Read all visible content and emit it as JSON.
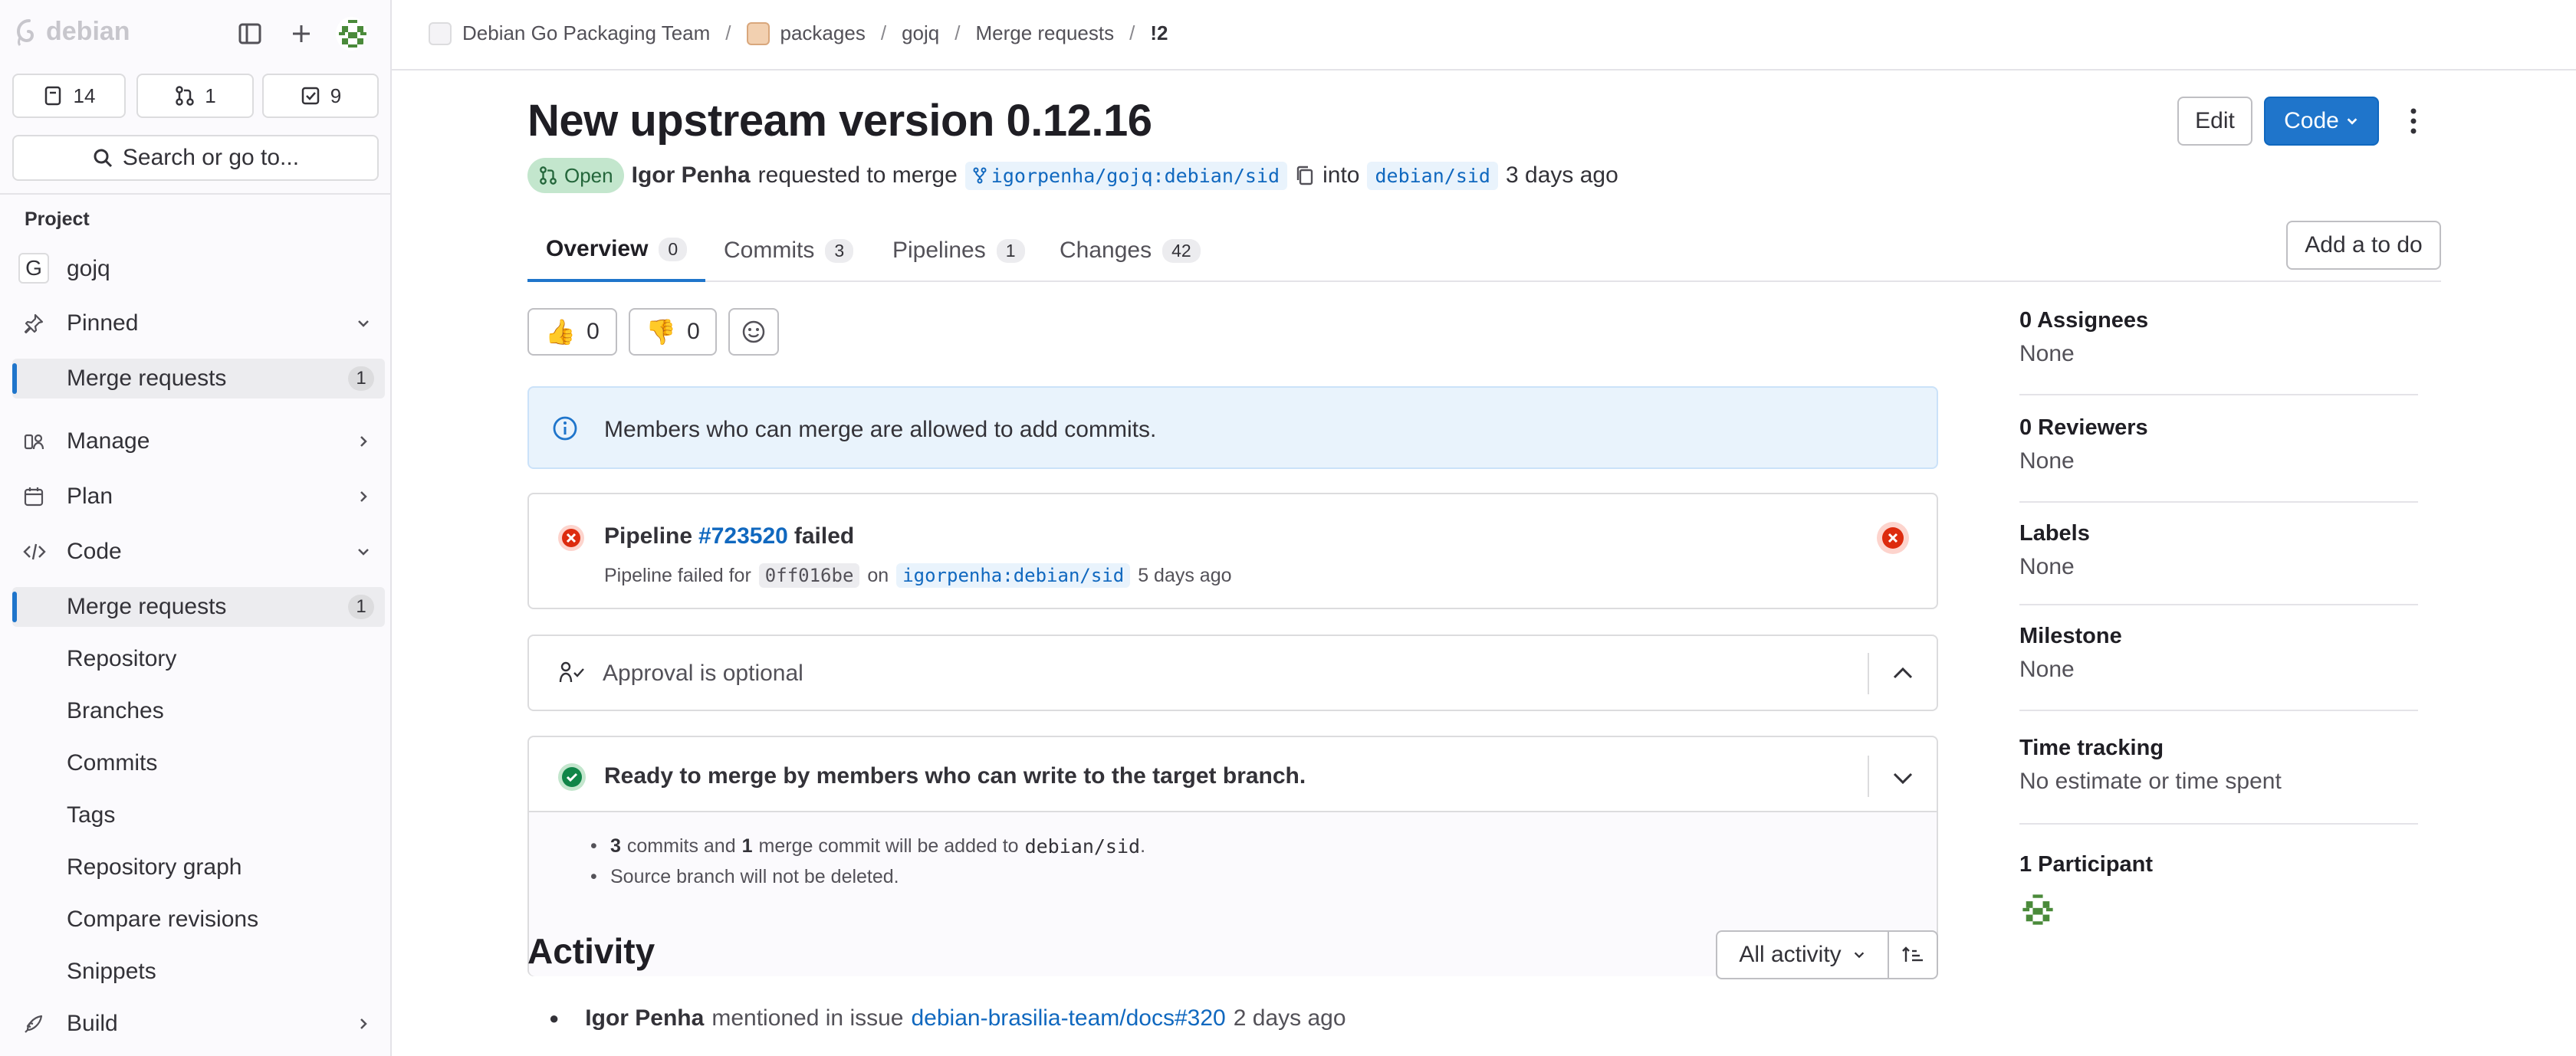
{
  "sidebar": {
    "logo_text": "debian",
    "counters": [
      {
        "icon": "issues-icon",
        "count": "14"
      },
      {
        "icon": "merge-request-icon",
        "count": "1"
      },
      {
        "icon": "todo-icon",
        "count": "9"
      }
    ],
    "search_label": "Search or go to...",
    "section_label": "Project",
    "project_initial": "G",
    "project_name": "gojq",
    "pinned_label": "Pinned",
    "pinned_items": [
      {
        "label": "Merge requests",
        "count": "1"
      }
    ],
    "manage_label": "Manage",
    "plan_label": "Plan",
    "code_label": "Code",
    "code_items": [
      {
        "label": "Merge requests",
        "count": "1"
      },
      {
        "label": "Repository"
      },
      {
        "label": "Branches"
      },
      {
        "label": "Commits"
      },
      {
        "label": "Tags"
      },
      {
        "label": "Repository graph"
      },
      {
        "label": "Compare revisions"
      },
      {
        "label": "Snippets"
      }
    ],
    "build_label": "Build"
  },
  "breadcrumb": [
    "Debian Go Packaging Team",
    "packages",
    "gojq",
    "Merge requests",
    "!2"
  ],
  "mr": {
    "title": "New upstream version 0.12.16",
    "edit_label": "Edit",
    "code_label": "Code",
    "status": "Open",
    "author": "Igor Penha",
    "requested_text": "requested to merge",
    "source_branch": "igorpenha/gojq:debian/sid",
    "into_text": "into",
    "target_branch": "debian/sid",
    "age": "3 days ago",
    "todo_label": "Add a to do"
  },
  "tabs": [
    {
      "label": "Overview",
      "count": "0"
    },
    {
      "label": "Commits",
      "count": "3"
    },
    {
      "label": "Pipelines",
      "count": "1"
    },
    {
      "label": "Changes",
      "count": "42"
    }
  ],
  "reactions": {
    "thumbs_up": "0",
    "thumbs_down": "0",
    "thumbs_up_glyph": "👍",
    "thumbs_down_glyph": "👎"
  },
  "info_banner": "Members who can merge are allowed to add commits.",
  "pipeline": {
    "label": "Pipeline",
    "id": "#723520",
    "status": "failed",
    "detail_prefix": "Pipeline failed for",
    "commit": "0ff016be",
    "on_text": "on",
    "branch": "igorpenha:debian/sid",
    "age": "5 days ago"
  },
  "approval": {
    "text": "Approval is optional"
  },
  "merge": {
    "title": "Ready to merge by members who can write to the target branch.",
    "line1_a": "3",
    "line1_b": "commits and",
    "line1_c": "1",
    "line1_d": "merge commit will be added to",
    "line1_branch": "debian/sid",
    "line1_end": ".",
    "line2": "Source branch will not be deleted."
  },
  "activity": {
    "heading": "Activity",
    "filter_label": "All activity",
    "item_author": "Igor Penha",
    "item_text": "mentioned in issue",
    "item_link": "debian-brasilia-team/docs#320",
    "item_age": "2 days ago"
  },
  "rightside": {
    "assignees_label": "0 Assignees",
    "assignees_value": "None",
    "reviewers_label": "0 Reviewers",
    "reviewers_value": "None",
    "labels_label": "Labels",
    "labels_value": "None",
    "milestone_label": "Milestone",
    "milestone_value": "None",
    "time_label": "Time tracking",
    "time_value": "No estimate or time spent",
    "participants_label": "1 Participant"
  },
  "colors": {
    "accent": "#1f75cb",
    "success": "#108548",
    "danger": "#dd2b0e",
    "open_badge_bg": "#c3e6cd"
  }
}
